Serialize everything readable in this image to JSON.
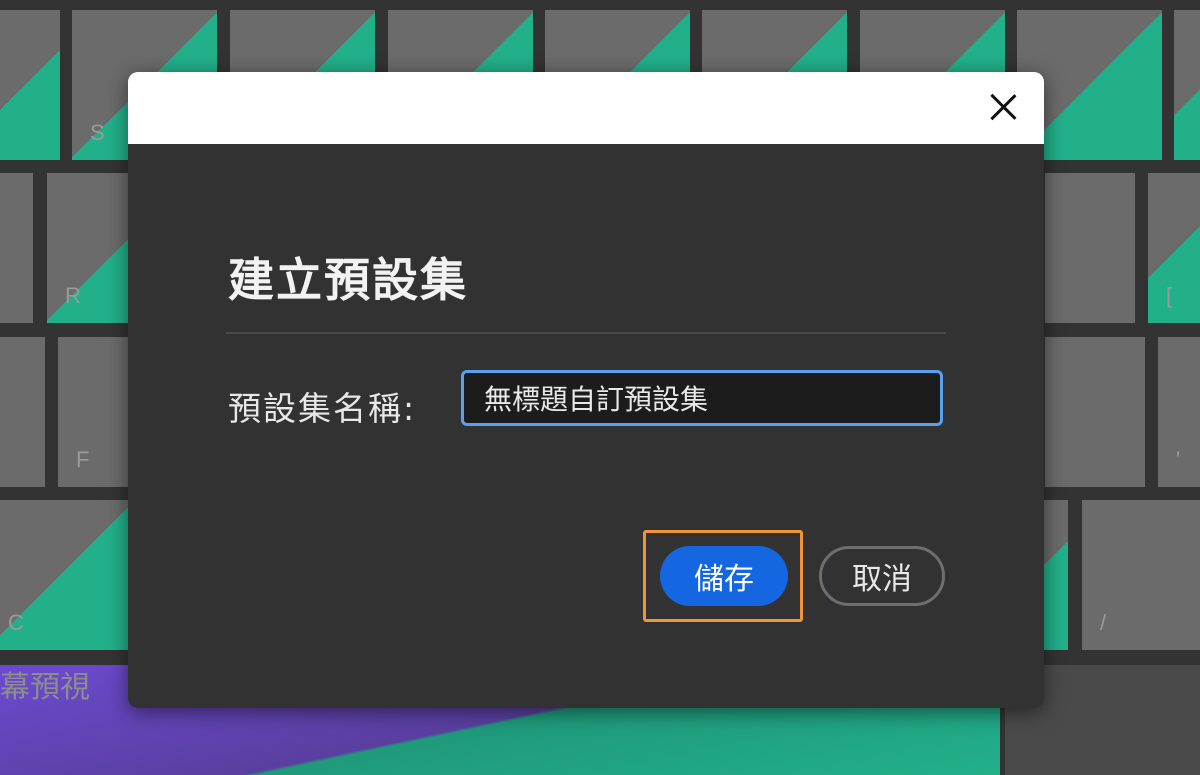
{
  "background": {
    "key_labels": [
      "S",
      "R",
      "F",
      "C",
      "[",
      "'",
      "/"
    ],
    "preview_label": "幕預視",
    "colors": {
      "key": "#6b6b6b",
      "accent_green": "#22b089",
      "purple": "#6c4ad0"
    }
  },
  "dialog": {
    "title": "建立預設集",
    "field_label": "預設集名稱:",
    "name_value": "無標題自訂預設集",
    "save_label": "儲存",
    "cancel_label": "取消",
    "close_icon": "close-icon",
    "colors": {
      "primary": "#1467e0",
      "highlight": "#f0943a",
      "input_focus": "#5aa0ec",
      "body": "#323232"
    }
  }
}
